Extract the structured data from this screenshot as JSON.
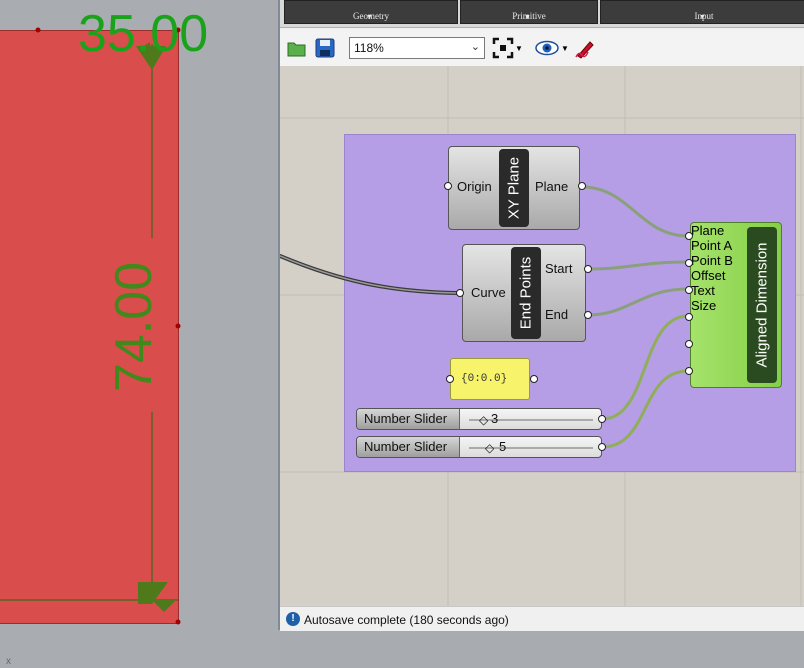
{
  "rhino_viewport": {
    "dimension_horizontal": "35.00",
    "dimension_vertical": "74.00",
    "axis_label": "x",
    "colors": {
      "rectangle": "#d94d4d",
      "dimension": "#1aa31a"
    }
  },
  "gh_window": {
    "ribbon": {
      "groups": [
        {
          "label": "Geometry"
        },
        {
          "label": "Primitive"
        },
        {
          "label": "Input"
        }
      ]
    },
    "toolbar": {
      "zoom": "118%",
      "icons": [
        "open-folder-icon",
        "save-icon",
        "zoom-extents-icon",
        "preview-eye-icon",
        "sketch-pen-icon"
      ]
    },
    "status": {
      "text": "Autosave complete (180 seconds ago)"
    }
  },
  "canvas": {
    "group_color": "#b59ee6",
    "components": {
      "xy_plane": {
        "title": "XY Plane",
        "input": "Origin",
        "output": "Plane"
      },
      "end_points": {
        "title": "End Points",
        "input": "Curve",
        "outputs": [
          "Start",
          "End"
        ]
      },
      "panel": {
        "text": "{0:0.0}"
      },
      "slider1": {
        "name": "Number Slider",
        "value": "3"
      },
      "slider2": {
        "name": "Number Slider",
        "value": "5"
      },
      "aligned_dimension": {
        "title": "Aligned Dimension",
        "inputs": [
          "Plane",
          "Point A",
          "Point B",
          "Offset",
          "Text",
          "Size"
        ]
      }
    }
  }
}
